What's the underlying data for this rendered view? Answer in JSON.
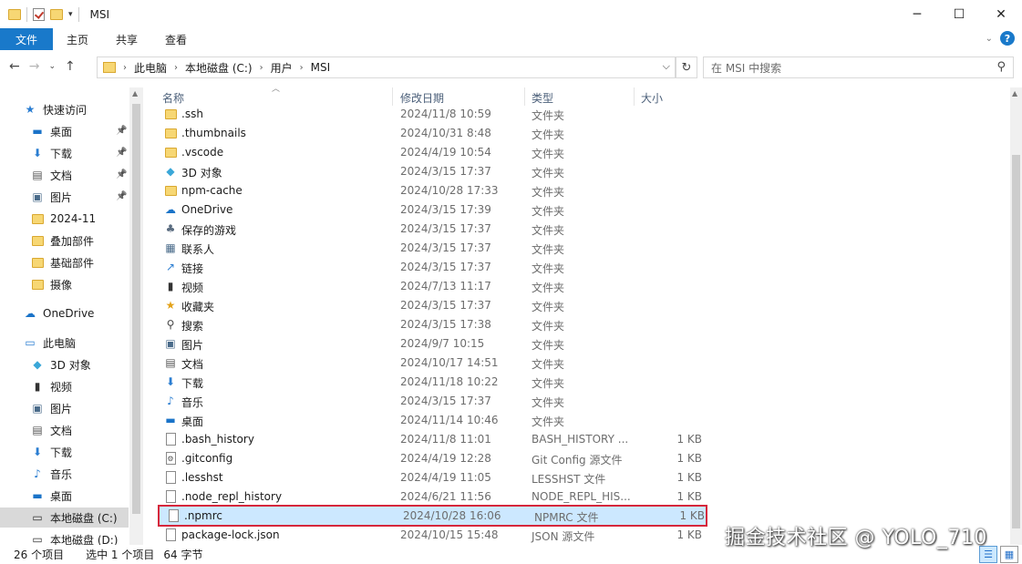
{
  "window": {
    "title": "MSI",
    "min_icon": "─",
    "max_icon": "☐",
    "close_icon": "✕"
  },
  "ribbon": {
    "tabs": [
      "文件",
      "主页",
      "共享",
      "查看"
    ]
  },
  "address": {
    "crumbs": [
      "此电脑",
      "本地磁盘 (C:)",
      "用户",
      "MSI"
    ]
  },
  "search": {
    "placeholder": "在 MSI 中搜索"
  },
  "nav": {
    "quick_access": "快速访问",
    "items": [
      {
        "label": "桌面",
        "icon": "desktop-icon",
        "pinned": true
      },
      {
        "label": "下载",
        "icon": "download-icon",
        "pinned": true
      },
      {
        "label": "文档",
        "icon": "document-icon",
        "pinned": true
      },
      {
        "label": "图片",
        "icon": "picture-icon",
        "pinned": true
      },
      {
        "label": "2024-11",
        "icon": "folder-icon",
        "pinned": false
      },
      {
        "label": "叠加部件",
        "icon": "folder-icon",
        "pinned": false
      },
      {
        "label": "基础部件",
        "icon": "folder-icon",
        "pinned": false
      },
      {
        "label": "摄像",
        "icon": "folder-icon",
        "pinned": false
      }
    ],
    "onedrive": "OneDrive",
    "this_pc": "此电脑",
    "pc_items": [
      {
        "label": "3D 对象",
        "icon": "3d-objects-icon"
      },
      {
        "label": "视频",
        "icon": "video-icon"
      },
      {
        "label": "图片",
        "icon": "picture-icon"
      },
      {
        "label": "文档",
        "icon": "document-icon"
      },
      {
        "label": "下载",
        "icon": "download-icon"
      },
      {
        "label": "音乐",
        "icon": "music-icon"
      },
      {
        "label": "桌面",
        "icon": "desktop-icon"
      },
      {
        "label": "本地磁盘 (C:)",
        "icon": "drive-icon",
        "selected": true
      },
      {
        "label": "本地磁盘 (D:)",
        "icon": "drive-icon"
      }
    ]
  },
  "columns": {
    "name": "名称",
    "date": "修改日期",
    "type": "类型",
    "size": "大小"
  },
  "files": [
    {
      "name": ".ssh",
      "date": "2024/11/8 10:59",
      "type": "文件夹",
      "size": "",
      "icon": "folder-icon"
    },
    {
      "name": ".thumbnails",
      "date": "2024/10/31 8:48",
      "type": "文件夹",
      "size": "",
      "icon": "folder-icon"
    },
    {
      "name": ".vscode",
      "date": "2024/4/19 10:54",
      "type": "文件夹",
      "size": "",
      "icon": "folder-icon"
    },
    {
      "name": "3D 对象",
      "date": "2024/3/15 17:37",
      "type": "文件夹",
      "size": "",
      "icon": "3d-objects-icon"
    },
    {
      "name": "npm-cache",
      "date": "2024/10/28 17:33",
      "type": "文件夹",
      "size": "",
      "icon": "folder-icon"
    },
    {
      "name": "OneDrive",
      "date": "2024/3/15 17:39",
      "type": "文件夹",
      "size": "",
      "icon": "onedrive-icon"
    },
    {
      "name": "保存的游戏",
      "date": "2024/3/15 17:37",
      "type": "文件夹",
      "size": "",
      "icon": "saved-games-icon"
    },
    {
      "name": "联系人",
      "date": "2024/3/15 17:37",
      "type": "文件夹",
      "size": "",
      "icon": "contacts-icon"
    },
    {
      "name": "链接",
      "date": "2024/3/15 17:37",
      "type": "文件夹",
      "size": "",
      "icon": "links-icon"
    },
    {
      "name": "视频",
      "date": "2024/7/13 11:17",
      "type": "文件夹",
      "size": "",
      "icon": "video-icon"
    },
    {
      "name": "收藏夹",
      "date": "2024/3/15 17:37",
      "type": "文件夹",
      "size": "",
      "icon": "favorites-icon"
    },
    {
      "name": "搜索",
      "date": "2024/3/15 17:38",
      "type": "文件夹",
      "size": "",
      "icon": "search-icon"
    },
    {
      "name": "图片",
      "date": "2024/9/7 10:15",
      "type": "文件夹",
      "size": "",
      "icon": "picture-icon"
    },
    {
      "name": "文档",
      "date": "2024/10/17 14:51",
      "type": "文件夹",
      "size": "",
      "icon": "document-icon"
    },
    {
      "name": "下载",
      "date": "2024/11/18 10:22",
      "type": "文件夹",
      "size": "",
      "icon": "download-icon"
    },
    {
      "name": "音乐",
      "date": "2024/3/15 17:37",
      "type": "文件夹",
      "size": "",
      "icon": "music-icon"
    },
    {
      "name": "桌面",
      "date": "2024/11/14 10:46",
      "type": "文件夹",
      "size": "",
      "icon": "desktop-icon"
    },
    {
      "name": ".bash_history",
      "date": "2024/11/8 11:01",
      "type": "BASH_HISTORY ...",
      "size": "1 KB",
      "icon": "file-icon"
    },
    {
      "name": ".gitconfig",
      "date": "2024/4/19 12:28",
      "type": "Git Config 源文件",
      "size": "1 KB",
      "icon": "config-file-icon"
    },
    {
      "name": ".lesshst",
      "date": "2024/4/19 11:05",
      "type": "LESSHST 文件",
      "size": "1 KB",
      "icon": "file-icon"
    },
    {
      "name": ".node_repl_history",
      "date": "2024/6/21 11:56",
      "type": "NODE_REPL_HIS...",
      "size": "1 KB",
      "icon": "file-icon"
    },
    {
      "name": ".npmrc",
      "date": "2024/10/28 16:06",
      "type": "NPMRC 文件",
      "size": "1 KB",
      "icon": "file-icon",
      "selected": true
    },
    {
      "name": "package-lock.json",
      "date": "2024/10/15 15:48",
      "type": "JSON 源文件",
      "size": "1 KB",
      "icon": "file-icon"
    }
  ],
  "status": {
    "count": "26 个项目",
    "selected": "选中 1 个项目",
    "size": "64 字节"
  },
  "watermark": "掘金技术社区 @ YOLO_710",
  "colors": {
    "accent": "#1979ca",
    "selection": "#cce8ff",
    "highlight_border": "#d6273b"
  }
}
